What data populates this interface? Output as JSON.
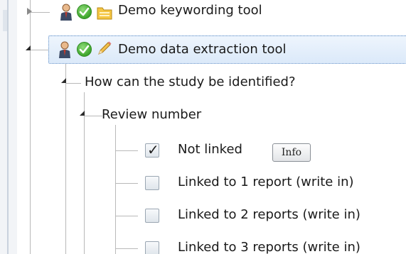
{
  "tree": {
    "top_item": {
      "label": "Demo keywording tool",
      "icons": [
        "person-icon",
        "check-icon",
        "folder-icon"
      ]
    },
    "selected_item": {
      "label": "Demo data extraction tool",
      "icons": [
        "person-icon",
        "check-icon",
        "pencil-icon"
      ]
    },
    "question": {
      "label": "How can the study be identified?"
    },
    "section": {
      "label": "Review number"
    },
    "options": [
      {
        "label": "Not linked",
        "checked": true,
        "info_label": "Info"
      },
      {
        "label": "Linked to 1 report (write in)",
        "checked": false
      },
      {
        "label": "Linked to 2 reports (write in)",
        "checked": false
      },
      {
        "label": "Linked to 3 reports (write in)",
        "checked": false
      }
    ]
  },
  "colors": {
    "selection_border": "#5a8bc5",
    "selection_fill": "#dbe9f9",
    "check_green": "#3ea52c"
  }
}
